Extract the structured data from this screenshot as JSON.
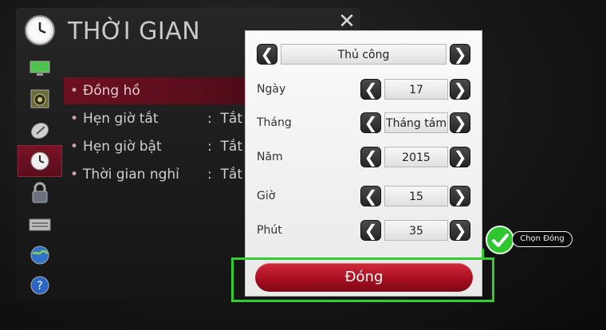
{
  "header": {
    "title": "THỜI GIAN",
    "close_symbol": "✕"
  },
  "sidebar": {
    "items": [
      {
        "icon": "picture-icon"
      },
      {
        "icon": "speaker-icon"
      },
      {
        "icon": "satellite-dish-icon"
      },
      {
        "icon": "clock-icon",
        "selected": true
      },
      {
        "icon": "lock-icon"
      },
      {
        "icon": "keyboard-icon"
      },
      {
        "icon": "globe-icon"
      },
      {
        "icon": "help-icon"
      }
    ]
  },
  "menu": {
    "items": [
      {
        "label": "Đồng hồ",
        "value": ""
      },
      {
        "label": "Hẹn giờ tắt",
        "value": "Tắt"
      },
      {
        "label": "Hẹn giờ bật",
        "value": "Tắt"
      },
      {
        "label": "Thời gian nghỉ",
        "value": "Tắt"
      }
    ],
    "separator": ":"
  },
  "dialog": {
    "mode_value": "Thủ công",
    "fields": [
      {
        "label": "Ngày",
        "value": "17"
      },
      {
        "label": "Tháng",
        "value": "Tháng tám"
      },
      {
        "label": "Năm",
        "value": "2015"
      },
      {
        "label": "Giờ",
        "value": "15"
      },
      {
        "label": "Phút",
        "value": "35"
      }
    ],
    "arrow_left": "❮",
    "arrow_right": "❯",
    "close_label": "Đóng"
  },
  "annotation": {
    "callout_text": "Chọn Đóng",
    "highlight_color": "#33cc33"
  }
}
